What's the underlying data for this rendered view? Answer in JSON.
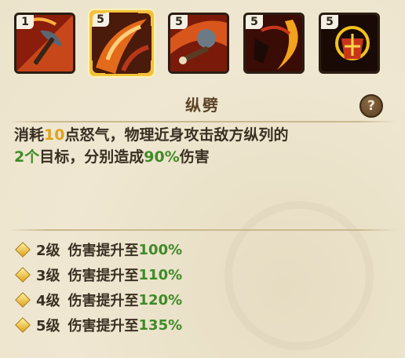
{
  "skills": [
    {
      "level": "1",
      "name": "axe-skill-icon",
      "selected": false
    },
    {
      "level": "5",
      "name": "cleave-skill-icon",
      "selected": true
    },
    {
      "level": "5",
      "name": "hammer-skill-icon",
      "selected": false
    },
    {
      "level": "5",
      "name": "crescent-slash-skill-icon",
      "selected": false
    },
    {
      "level": "5",
      "name": "shield-skill-icon",
      "selected": false
    }
  ],
  "skill_title": "纵劈",
  "help_label": "?",
  "description": {
    "p1": "消耗",
    "rage": "10",
    "p2": "点怒气，物理近身攻击敌方纵列的",
    "targets": "2个",
    "p3": "目标，分别造成",
    "damage": "90%",
    "p4": "伤害"
  },
  "upgrades": [
    {
      "level": "2级",
      "text": "伤害提升至",
      "value": "100%"
    },
    {
      "level": "3级",
      "text": "伤害提升至",
      "value": "110%"
    },
    {
      "level": "4级",
      "text": "伤害提升至",
      "value": "120%"
    },
    {
      "level": "5级",
      "text": "伤害提升至",
      "value": "135%"
    }
  ],
  "colors": {
    "highlight_orange": "#e0a21b",
    "highlight_green": "#3f8a28",
    "selected_frame": "#f4c23a"
  }
}
